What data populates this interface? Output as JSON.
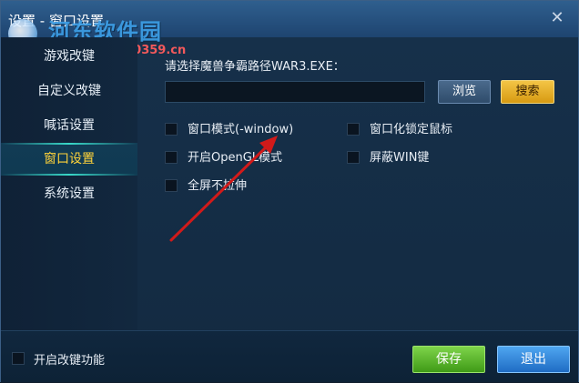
{
  "window": {
    "title": "设置 - 窗口设置",
    "close_symbol": "✕"
  },
  "watermark": {
    "site_name": "河东软件园",
    "url": "www.pc0359.cn"
  },
  "sidebar": {
    "items": [
      {
        "label": "游戏改键",
        "active": false
      },
      {
        "label": "自定义改键",
        "active": false
      },
      {
        "label": "喊话设置",
        "active": false
      },
      {
        "label": "窗口设置",
        "active": true
      },
      {
        "label": "系统设置",
        "active": false
      }
    ]
  },
  "main": {
    "path_label": "请选择魔兽争霸路径WAR3.EXE：",
    "path_value": "",
    "browse_label": "浏览",
    "search_label": "搜索",
    "options": [
      {
        "label": "窗口模式(-window)",
        "checked": false
      },
      {
        "label": "窗口化锁定鼠标",
        "checked": false
      },
      {
        "label": "开启OpenGL模式",
        "checked": false
      },
      {
        "label": "屏蔽WIN键",
        "checked": false
      },
      {
        "label": "全屏不拉伸",
        "checked": false
      }
    ]
  },
  "footer": {
    "remap_label": "开启改键功能",
    "remap_checked": false,
    "save_label": "保存",
    "exit_label": "退出"
  },
  "colors": {
    "accent_active": "#ffd33a",
    "save_green": "#5cb82a",
    "exit_blue": "#2f86dc",
    "search_gold": "#e8b42e",
    "annotation_arrow": "#d11a1a"
  },
  "icons": {
    "close": "close-icon",
    "logo": "logo-icon",
    "annotation": "arrow-icon"
  }
}
